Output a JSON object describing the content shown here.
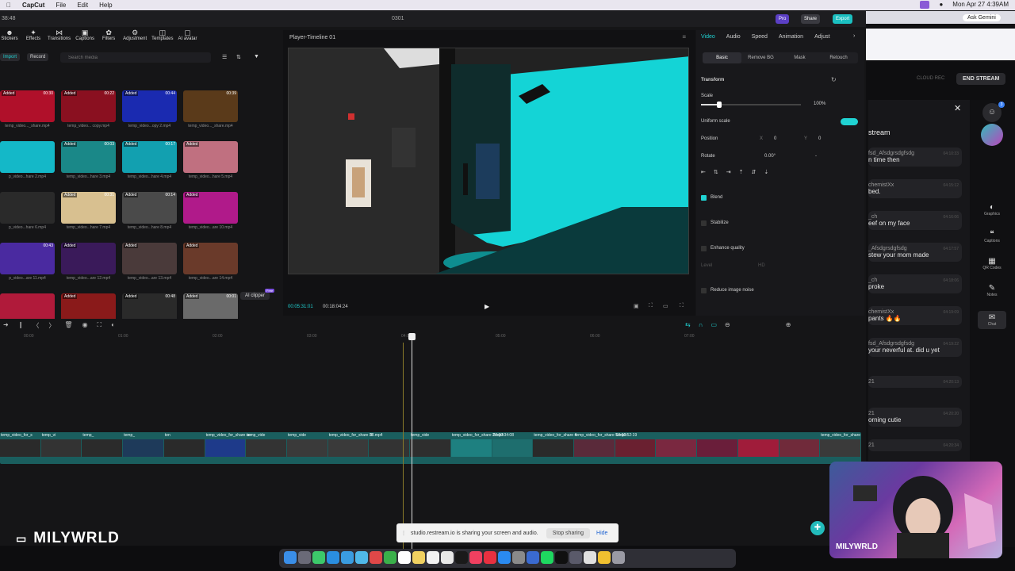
{
  "menubar": {
    "app_name": "CapCut",
    "menus": [
      "File",
      "Edit",
      "Help"
    ],
    "clock": "Mon Apr 27  4:39AM"
  },
  "capcut": {
    "window_title": "0301",
    "elapsed": "38:48",
    "pro_label": "Pro",
    "share_label": "Share",
    "export_label": "Export",
    "tools": [
      {
        "label": "Stickers",
        "icon": "sticker-icon"
      },
      {
        "label": "Effects",
        "icon": "effects-icon"
      },
      {
        "label": "Transitions",
        "icon": "transitions-icon"
      },
      {
        "label": "Captions",
        "icon": "captions-icon"
      },
      {
        "label": "Filters",
        "icon": "filters-icon"
      },
      {
        "label": "Adjustment",
        "icon": "adjustment-icon"
      },
      {
        "label": "Templates",
        "icon": "templates-icon"
      },
      {
        "label": "AI avatar",
        "icon": "ai-avatar-icon"
      }
    ],
    "import_label": "Import",
    "record_label": "Record",
    "search_placeholder": "Search media",
    "media": [
      {
        "tag": "Added",
        "duration": "00:30",
        "label": "temp_video..._share.mp4"
      },
      {
        "tag": "Added",
        "duration": "00:22",
        "label": "temp_video... copy.mp4"
      },
      {
        "tag": "Added",
        "duration": "00:44",
        "label": "temp_video...opy 2.mp4"
      },
      {
        "tag": "",
        "duration": "00:39",
        "label": "temp_video..._share.mp4"
      },
      {
        "tag": "",
        "duration": "",
        "label": "p_video...hare 2.mp4"
      },
      {
        "tag": "Added",
        "duration": "00:03",
        "label": "temp_video...hare 3.mp4"
      },
      {
        "tag": "Added",
        "duration": "00:17",
        "label": "temp_video...hare 4.mp4"
      },
      {
        "tag": "Added",
        "duration": "",
        "label": "temp_video...hare 5.mp4"
      },
      {
        "tag": "",
        "duration": "",
        "label": "p_video...hare 6.mp4"
      },
      {
        "tag": "Added",
        "duration": "00:31",
        "label": "temp_video...hare 7.mp4"
      },
      {
        "tag": "Added",
        "duration": "00:14",
        "label": "temp_video...hare 8.mp4"
      },
      {
        "tag": "Added",
        "duration": "",
        "label": "temp_video...are 10.mp4"
      },
      {
        "tag": "",
        "duration": "00:43",
        "label": "p_video...are 11.mp4"
      },
      {
        "tag": "Added",
        "duration": "",
        "label": "temp_video...are 12.mp4"
      },
      {
        "tag": "Added",
        "duration": "",
        "label": "temp_video...are 13.mp4"
      },
      {
        "tag": "Added",
        "duration": "",
        "label": "temp_video...are 14.mp4"
      },
      {
        "tag": "",
        "duration": "",
        "label": ""
      },
      {
        "tag": "Added",
        "duration": "",
        "label": ""
      },
      {
        "tag": "Added",
        "duration": "00:48",
        "label": ""
      },
      {
        "tag": "Added",
        "duration": "00:01",
        "label": ""
      }
    ],
    "ai_clipper_label": "AI clipper",
    "ai_clipper_badge": "Free",
    "player": {
      "title": "Player-Timeline 01",
      "current_time": "00:05:31:01",
      "total_time": "00:18:04:24"
    },
    "properties": {
      "tabs": [
        "Video",
        "Audio",
        "Speed",
        "Animation",
        "Adjust"
      ],
      "subtabs": [
        "Basic",
        "Remove BG",
        "Mask",
        "Retouch"
      ],
      "transform_label": "Transform",
      "scale_label": "Scale",
      "scale_value": "100%",
      "scale_level": 0.18,
      "uniform_scale_label": "Uniform scale",
      "position_label": "Position",
      "pos_x_label": "X",
      "pos_x": "0",
      "pos_y_label": "Y",
      "pos_y": "0",
      "rotate_label": "Rotate",
      "rotate_value": "0.00°",
      "rotate_dash": "-",
      "blend_label": "Blend",
      "stabilize_label": "Stabilize",
      "enhance_label": "Enhance quality",
      "level_label": "Level",
      "level_value": "HD",
      "reduce_noise_label": "Reduce image noise"
    },
    "ruler": [
      "00:00",
      "01:00",
      "02:00",
      "03:00",
      "04:00",
      "05:00",
      "06:00",
      "07:00"
    ],
    "clips": [
      {
        "label": "temp_video_for_s",
        "color": "#2a2a2a"
      },
      {
        "label": "temp_vi",
        "color": "#333"
      },
      {
        "label": "temp_",
        "color": "#2b2b2b"
      },
      {
        "label": "temp_",
        "color": "#1e3a5a"
      },
      {
        "label": "ten",
        "color": "#2a2a2a"
      },
      {
        "label": "temp_video_for_share co",
        "color": "#1e3a8a"
      },
      {
        "label": "temp_vide",
        "color": "#333"
      },
      {
        "label": "temp_vide",
        "color": "#3a3a3a"
      },
      {
        "label": "temp_video_for_share 38.mp4",
        "color": "#3a3a3a"
      },
      {
        "label": "0",
        "color": "#333"
      },
      {
        "label": "temp_vide",
        "color": "#2e2e2e"
      },
      {
        "label": "temp_video_for_share 2.mp4",
        "color": "#1e8080"
      },
      {
        "label": "00:00:34:08",
        "color": "#1e6e6e"
      },
      {
        "label": "temp_video_for_share 4",
        "color": "#2a2a2a"
      },
      {
        "label": "temp_video_for_share 5.mp4",
        "color": "#5a2a3a"
      },
      {
        "label": "00:01:52:19",
        "color": "#6a2030"
      },
      {
        "label": "",
        "color": "#7a2840"
      },
      {
        "label": "",
        "color": "#6a1e3a"
      },
      {
        "label": "",
        "color": "#a01c3a"
      },
      {
        "label": "",
        "color": "#702a3a"
      },
      {
        "label": "temp_video_for_share",
        "color": "#3a3a3a"
      }
    ]
  },
  "restream": {
    "cloud_rec": "CLOUD REC",
    "end_stream": "END STREAM",
    "ask_gemini": "Ask Gemini",
    "chat_title": "stream",
    "messages": [
      {
        "user": "fsd_Afsdgrsdgfsdg",
        "text": "n time then",
        "time": "04:10:33"
      },
      {
        "user": "chemistXx",
        "text": "bed.",
        "time": "04:15:12"
      },
      {
        "user": "_ch",
        "text": "eef on my face",
        "time": "04:16:06"
      },
      {
        "user": "_Afsdgrsdgfsdg",
        "text": "stew your mom made",
        "time": "04:17:57"
      },
      {
        "user": "_ch",
        "text": "proke",
        "time": "04:18:06"
      },
      {
        "user": "chemistXx",
        "text": "pants 🔥🔥",
        "time": "04:19:09"
      },
      {
        "user": "fsd_Afsdgrsdgfsdg",
        "text": "your neverful at. did u yet",
        "time": "04:19:22"
      },
      {
        "user": "21",
        "text": "",
        "time": "04:20:13"
      },
      {
        "user": "21",
        "text": "orning cutie",
        "time": "04:20:20"
      },
      {
        "user": "21",
        "text": "",
        "time": "04:20:34"
      }
    ],
    "sidebar": [
      {
        "label": "Graphics",
        "icon": "graphics-icon"
      },
      {
        "label": "Captions",
        "icon": "captions-icon"
      },
      {
        "label": "QR Codes",
        "icon": "qr-code-icon"
      },
      {
        "label": "Notes",
        "icon": "notes-icon"
      },
      {
        "label": "Chat",
        "icon": "chat-icon"
      }
    ],
    "avatar_badge": "3"
  },
  "webcam": {
    "name": "MILYWRLD"
  },
  "brand": {
    "name": "MILYWRLD"
  },
  "share_bar": {
    "text": "studio.restream.io is sharing your screen and audio.",
    "stop_label": "Stop sharing",
    "hide_label": "Hide"
  }
}
